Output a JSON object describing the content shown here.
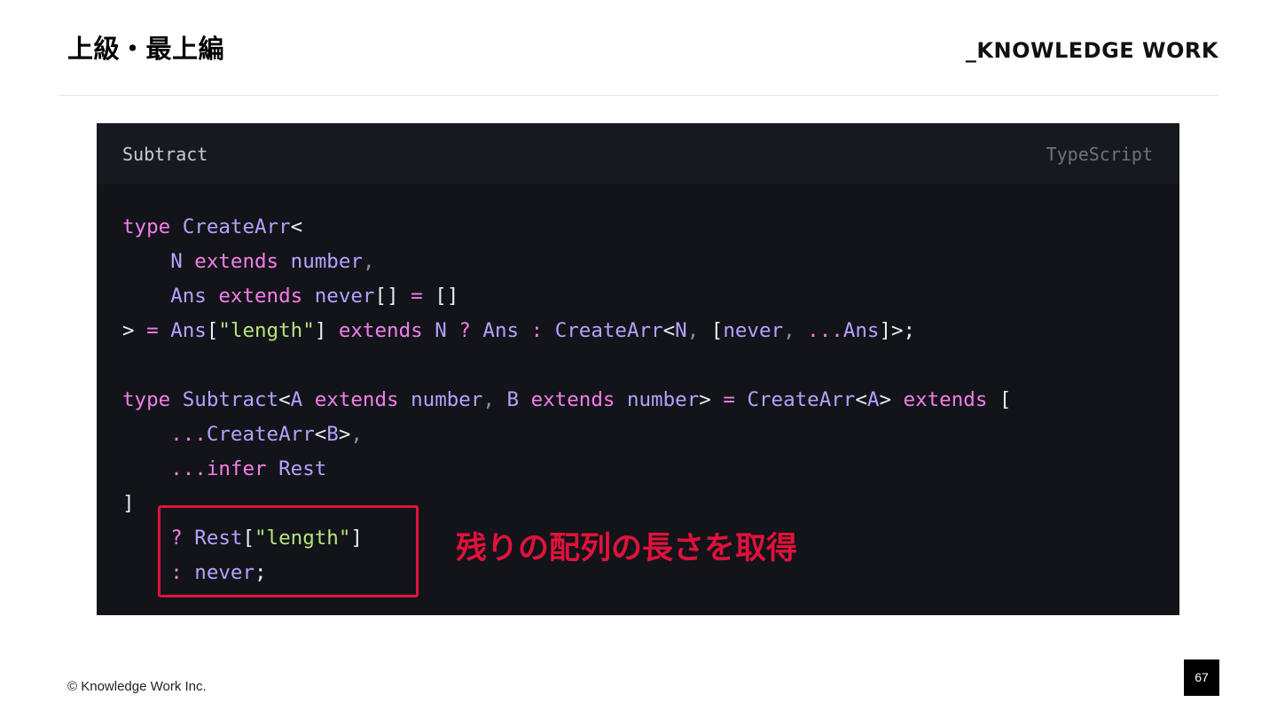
{
  "slide": {
    "title": "上級・最上編",
    "brand": "_KNOWLEDGE WORK",
    "copyright": "© Knowledge Work Inc.",
    "page_number": "67"
  },
  "code_block": {
    "filename": "Subtract",
    "language": "TypeScript",
    "lines": [
      [
        {
          "t": "type",
          "c": "kw"
        },
        {
          "t": " ",
          "c": "plain"
        },
        {
          "t": "CreateArr",
          "c": "type"
        },
        {
          "t": "<",
          "c": "punct"
        }
      ],
      [
        {
          "t": "    ",
          "c": "plain"
        },
        {
          "t": "N",
          "c": "type"
        },
        {
          "t": " ",
          "c": "plain"
        },
        {
          "t": "extends",
          "c": "kw"
        },
        {
          "t": " ",
          "c": "plain"
        },
        {
          "t": "number",
          "c": "type"
        },
        {
          "t": ",",
          "c": "comma"
        }
      ],
      [
        {
          "t": "    ",
          "c": "plain"
        },
        {
          "t": "Ans",
          "c": "type"
        },
        {
          "t": " ",
          "c": "plain"
        },
        {
          "t": "extends",
          "c": "kw"
        },
        {
          "t": " ",
          "c": "plain"
        },
        {
          "t": "never",
          "c": "type"
        },
        {
          "t": "[]",
          "c": "punct"
        },
        {
          "t": " ",
          "c": "plain"
        },
        {
          "t": "=",
          "c": "kw"
        },
        {
          "t": " ",
          "c": "plain"
        },
        {
          "t": "[]",
          "c": "punct"
        }
      ],
      [
        {
          "t": ">",
          "c": "punct"
        },
        {
          "t": " ",
          "c": "plain"
        },
        {
          "t": "=",
          "c": "kw"
        },
        {
          "t": " ",
          "c": "plain"
        },
        {
          "t": "Ans",
          "c": "type"
        },
        {
          "t": "[",
          "c": "punct"
        },
        {
          "t": "\"length\"",
          "c": "str"
        },
        {
          "t": "]",
          "c": "punct"
        },
        {
          "t": " ",
          "c": "plain"
        },
        {
          "t": "extends",
          "c": "kw"
        },
        {
          "t": " ",
          "c": "plain"
        },
        {
          "t": "N",
          "c": "type"
        },
        {
          "t": " ",
          "c": "plain"
        },
        {
          "t": "?",
          "c": "kw"
        },
        {
          "t": " ",
          "c": "plain"
        },
        {
          "t": "Ans",
          "c": "type"
        },
        {
          "t": " ",
          "c": "plain"
        },
        {
          "t": ":",
          "c": "kw"
        },
        {
          "t": " ",
          "c": "plain"
        },
        {
          "t": "CreateArr",
          "c": "type"
        },
        {
          "t": "<",
          "c": "punct"
        },
        {
          "t": "N",
          "c": "type"
        },
        {
          "t": ",",
          "c": "comma"
        },
        {
          "t": " ",
          "c": "plain"
        },
        {
          "t": "[",
          "c": "punct"
        },
        {
          "t": "never",
          "c": "type"
        },
        {
          "t": ",",
          "c": "comma"
        },
        {
          "t": " ",
          "c": "plain"
        },
        {
          "t": "...",
          "c": "kw"
        },
        {
          "t": "Ans",
          "c": "type"
        },
        {
          "t": "]>;",
          "c": "punct"
        }
      ],
      [],
      [
        {
          "t": "type",
          "c": "kw"
        },
        {
          "t": " ",
          "c": "plain"
        },
        {
          "t": "Subtract",
          "c": "type"
        },
        {
          "t": "<",
          "c": "punct"
        },
        {
          "t": "A",
          "c": "type"
        },
        {
          "t": " ",
          "c": "plain"
        },
        {
          "t": "extends",
          "c": "kw"
        },
        {
          "t": " ",
          "c": "plain"
        },
        {
          "t": "number",
          "c": "type"
        },
        {
          "t": ",",
          "c": "comma"
        },
        {
          "t": " ",
          "c": "plain"
        },
        {
          "t": "B",
          "c": "type"
        },
        {
          "t": " ",
          "c": "plain"
        },
        {
          "t": "extends",
          "c": "kw"
        },
        {
          "t": " ",
          "c": "plain"
        },
        {
          "t": "number",
          "c": "type"
        },
        {
          "t": ">",
          "c": "punct"
        },
        {
          "t": " ",
          "c": "plain"
        },
        {
          "t": "=",
          "c": "kw"
        },
        {
          "t": " ",
          "c": "plain"
        },
        {
          "t": "CreateArr",
          "c": "type"
        },
        {
          "t": "<",
          "c": "punct"
        },
        {
          "t": "A",
          "c": "type"
        },
        {
          "t": ">",
          "c": "punct"
        },
        {
          "t": " ",
          "c": "plain"
        },
        {
          "t": "extends",
          "c": "kw"
        },
        {
          "t": " ",
          "c": "plain"
        },
        {
          "t": "[",
          "c": "punct"
        }
      ],
      [
        {
          "t": "    ",
          "c": "plain"
        },
        {
          "t": "...",
          "c": "kw"
        },
        {
          "t": "CreateArr",
          "c": "type"
        },
        {
          "t": "<",
          "c": "punct"
        },
        {
          "t": "B",
          "c": "type"
        },
        {
          "t": ">",
          "c": "punct"
        },
        {
          "t": ",",
          "c": "comma"
        }
      ],
      [
        {
          "t": "    ",
          "c": "plain"
        },
        {
          "t": "...",
          "c": "kw"
        },
        {
          "t": "infer",
          "c": "kw"
        },
        {
          "t": " ",
          "c": "plain"
        },
        {
          "t": "Rest",
          "c": "type"
        }
      ],
      [
        {
          "t": "]",
          "c": "punct"
        }
      ],
      [
        {
          "t": "    ",
          "c": "plain"
        },
        {
          "t": "?",
          "c": "kw"
        },
        {
          "t": " ",
          "c": "plain"
        },
        {
          "t": "Rest",
          "c": "type"
        },
        {
          "t": "[",
          "c": "punct"
        },
        {
          "t": "\"length\"",
          "c": "str"
        },
        {
          "t": "]",
          "c": "punct"
        }
      ],
      [
        {
          "t": "    ",
          "c": "plain"
        },
        {
          "t": ":",
          "c": "kw"
        },
        {
          "t": " ",
          "c": "plain"
        },
        {
          "t": "never",
          "c": "type"
        },
        {
          "t": ";",
          "c": "punct"
        }
      ]
    ]
  },
  "annotation": {
    "text": "残りの配列の長さを取得",
    "color": "#e0123c"
  },
  "syntax_colors": {
    "kw": "#f47ee8",
    "type": "#b4a2ff",
    "str": "#b6e57d",
    "punct": "#eceef4",
    "comma": "#8b8fa3",
    "plain": "#e4e4ec"
  }
}
